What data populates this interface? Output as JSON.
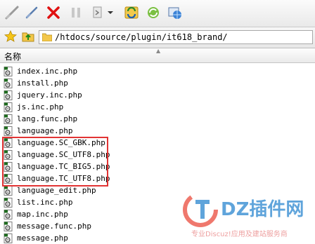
{
  "toolbar": {
    "buttons": [
      {
        "name": "disconnect",
        "icon": "disconnect-icon"
      },
      {
        "name": "connect",
        "icon": "connect-icon"
      },
      {
        "name": "cancel",
        "icon": "close-icon"
      },
      {
        "name": "pause",
        "icon": "pause-icon"
      },
      {
        "name": "transfer",
        "icon": "transfer-icon"
      },
      {
        "name": "sync",
        "icon": "sync-icon"
      },
      {
        "name": "refresh",
        "icon": "refresh-icon"
      },
      {
        "name": "site-manager",
        "icon": "globe-icon"
      }
    ]
  },
  "address": {
    "path": "/htdocs/source/plugin/it618_brand/"
  },
  "header": {
    "name_label": "名称",
    "sort_glyph": "▲"
  },
  "files": [
    {
      "name": "index.inc.php"
    },
    {
      "name": "install.php"
    },
    {
      "name": "jquery.inc.php"
    },
    {
      "name": "js.inc.php"
    },
    {
      "name": "lang.func.php"
    },
    {
      "name": "language.php"
    },
    {
      "name": "language.SC_GBK.php"
    },
    {
      "name": "language.SC_UTF8.php"
    },
    {
      "name": "language.TC_BIG5.php"
    },
    {
      "name": "language.TC_UTF8.php"
    },
    {
      "name": "language_edit.php"
    },
    {
      "name": "list.inc.php"
    },
    {
      "name": "map.inc.php"
    },
    {
      "name": "message.func.php"
    },
    {
      "name": "message.php"
    }
  ],
  "watermark": {
    "brand": "DZ插件网",
    "sub": "专业Discuz!应用及建站服务商"
  },
  "colors": {
    "highlight": "#e23434",
    "accent_blue": "#2a86cf"
  }
}
